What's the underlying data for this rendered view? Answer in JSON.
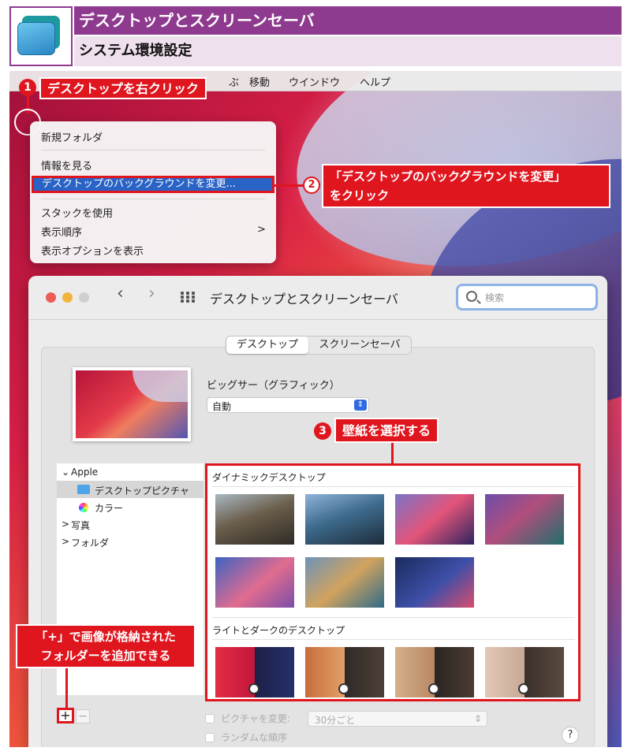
{
  "header": {
    "title": "デスクトップとスクリーンセーバ",
    "subtitle": "システム環境設定"
  },
  "menubar": {
    "items": [
      "ぶ",
      "移動",
      "ウインドウ",
      "ヘルプ"
    ]
  },
  "context_menu": {
    "items": [
      "新規フォルダ",
      "情報を見る",
      "デスクトップのバックグラウンドを変更...",
      "スタックを使用",
      "表示順序",
      "表示オプションを表示"
    ],
    "submenu_arrow": ">"
  },
  "annotations": {
    "step1": {
      "number": "1",
      "text": "デスクトップを右クリック"
    },
    "step2": {
      "number": "2",
      "line1": "「デスクトップのバックグラウンドを変更」",
      "line2": "をクリック"
    },
    "step3": {
      "number": "3",
      "text": "壁紙を選択する"
    },
    "plus_note": {
      "line1": "「+」で画像が格納された",
      "line2": "フォルダーを追加できる"
    }
  },
  "window": {
    "title": "デスクトップとスクリーンセーバ",
    "back_glyph": "‹",
    "forward_glyph": "›",
    "search_placeholder": "検索",
    "tabs": [
      "デスクトップ",
      "スクリーンセーバ"
    ],
    "wallpaper_name": "ビッグサー（グラフィック）",
    "mode_select": "自動",
    "sidebar": {
      "items": [
        {
          "label": "Apple",
          "prefix": "⌄"
        },
        {
          "label": "デスクトップピクチャ"
        },
        {
          "label": "カラー"
        },
        {
          "label": "写真",
          "prefix": ">"
        },
        {
          "label": "フォルダ",
          "prefix": ">"
        }
      ],
      "add_button": "+",
      "remove_button": "−"
    },
    "gallery": {
      "section1": "ダイナミックデスクトップ",
      "section2": "ライトとダークのデスクトップ"
    },
    "options": {
      "change_picture": "ピクチャを変更:",
      "interval": "30分ごと",
      "random_order": "ランダムな順序"
    },
    "help": "?"
  },
  "colors": {
    "accent_red": "#e0161f",
    "header_purple": "#8e3a8e",
    "selection_blue": "#2a63c6"
  }
}
